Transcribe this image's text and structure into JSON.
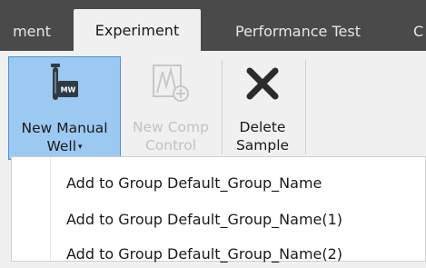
{
  "tabs": [
    {
      "label": "ment"
    },
    {
      "label": "Experiment"
    },
    {
      "label": "Performance Test"
    },
    {
      "label": "C"
    }
  ],
  "ribbon": {
    "new_manual_well_line1": "New Manual",
    "new_manual_well_line2": "Well",
    "new_manual_well_caret": "▾",
    "new_manual_well_icon_text": "MW",
    "new_comp_control_line1": "New Comp",
    "new_comp_control_line2": "Control",
    "delete_sample_line1": "Delete",
    "delete_sample_line2": "Sample"
  },
  "menu": {
    "items": [
      {
        "label": "Add to Group Default_Group_Name"
      },
      {
        "label": "Add to Group Default_Group_Name(1)"
      },
      {
        "label": "Add to Group Default_Group_Name(2)"
      }
    ]
  },
  "colors": {
    "tabbar_bg": "#4a4a4a",
    "selected_button_bg": "#9cc9f2",
    "selected_button_border": "#4d90d8",
    "disabled_text": "#c2c2c2"
  }
}
